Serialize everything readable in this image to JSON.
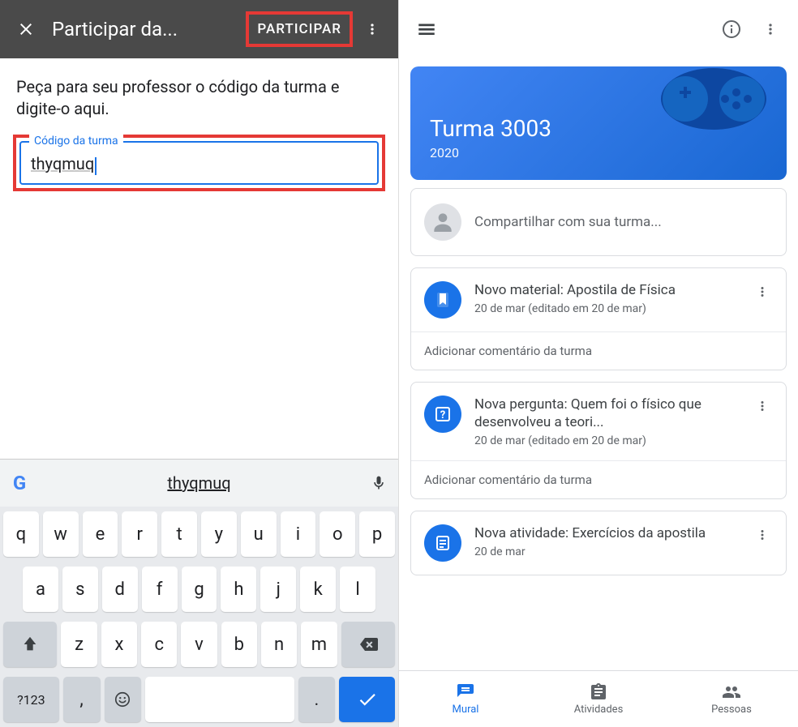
{
  "left": {
    "header": {
      "title": "Participar da...",
      "action": "PARTICIPAR"
    },
    "instruction": "Peça para seu professor o código da turma e digite-o aqui.",
    "field": {
      "label": "Código da turma",
      "value": "thyqmuq"
    },
    "keyboard": {
      "suggestion": "thyqmuq",
      "rows": {
        "r1": [
          "q",
          "w",
          "e",
          "r",
          "t",
          "y",
          "u",
          "i",
          "o",
          "p"
        ],
        "r2": [
          "a",
          "s",
          "d",
          "f",
          "g",
          "h",
          "j",
          "k",
          "l"
        ],
        "r3_mid": [
          "z",
          "x",
          "c",
          "v",
          "b",
          "n",
          "m"
        ],
        "r4": {
          "numkey": "?123",
          "comma": ",",
          "period": "."
        }
      }
    }
  },
  "right": {
    "class": {
      "name": "Turma 3003",
      "year": "2020"
    },
    "share_placeholder": "Compartilhar com sua turma...",
    "posts": [
      {
        "title": "Novo material: Apostila de Física",
        "date": "20 de mar (editado em 20 de mar)",
        "icon": "bookmark",
        "comment": "Adicionar comentário da turma"
      },
      {
        "title": "Nova pergunta: Quem foi o físico que desenvolveu a teori...",
        "date": "20 de mar (editado em 20 de mar)",
        "icon": "question",
        "comment": "Adicionar comentário da turma"
      },
      {
        "title": "Nova atividade: Exercícios da apostila",
        "date": "20 de mar",
        "icon": "assignment",
        "comment": ""
      }
    ],
    "nav": {
      "mural": "Mural",
      "atividades": "Atividades",
      "pessoas": "Pessoas"
    }
  }
}
